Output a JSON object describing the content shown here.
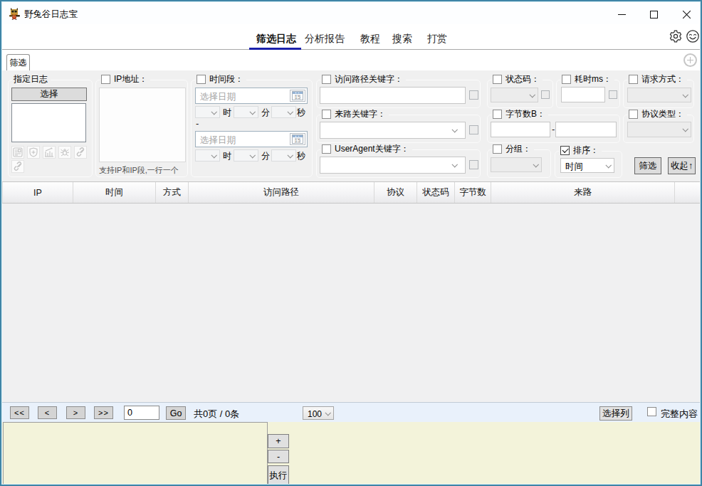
{
  "window": {
    "title": "野兔谷日志宝"
  },
  "nav": {
    "tabs": [
      {
        "label": "筛选日志",
        "active": true
      },
      {
        "label": "分析报告",
        "active": false
      },
      {
        "label": "教程",
        "active": false
      },
      {
        "label": "搜索",
        "active": false
      },
      {
        "label": "打赏",
        "active": false
      }
    ]
  },
  "tabstrip": {
    "tab_label": "筛选"
  },
  "filters": {
    "log_group": {
      "title": "指定日志",
      "select_button": "选择"
    },
    "ip": {
      "label": "IP地址：",
      "hint": "支持IP和IP段,一行一个"
    },
    "time": {
      "label": "时间段：",
      "date_placeholder": "选择日期",
      "calendar_day": "15",
      "hour_label": "时",
      "minute_label": "分",
      "second_label": "秒",
      "separator": "-"
    },
    "path": {
      "label": "访问路径关键字："
    },
    "referer": {
      "label": "来路关键字："
    },
    "useragent": {
      "label": "UserAgent关键字："
    },
    "status": {
      "label": "状态码："
    },
    "elapsed": {
      "label": "耗时ms："
    },
    "method": {
      "label": "请求方式："
    },
    "bytes": {
      "label": "字节数B：",
      "separator": "-"
    },
    "protocol": {
      "label": "协议类型："
    },
    "group": {
      "label": "分组："
    },
    "sort": {
      "label": "排序：",
      "value": "时间",
      "checked": true
    },
    "filter_button": "筛选",
    "collapse_button": "收起↑"
  },
  "table": {
    "columns": [
      "IP",
      "时间",
      "方式",
      "访问路径",
      "协议",
      "状态码",
      "字节数",
      "来路"
    ]
  },
  "pager": {
    "first": "<<",
    "prev": "<",
    "next": ">",
    "last": ">>",
    "page_value": "0",
    "go": "Go",
    "summary": "共0页 / 0条",
    "page_size": "100",
    "select_columns": "选择列",
    "full_content": "完整内容"
  },
  "bottom": {
    "plus": "+",
    "minus": "-",
    "execute": "执行"
  },
  "colors": {
    "accent_underline": "#1b21ab",
    "window_border": "#3f85a6",
    "panel_bg": "#f0f0f0",
    "pager_bg": "#e9f1fb",
    "bottom_bg": "#f3f3da"
  }
}
